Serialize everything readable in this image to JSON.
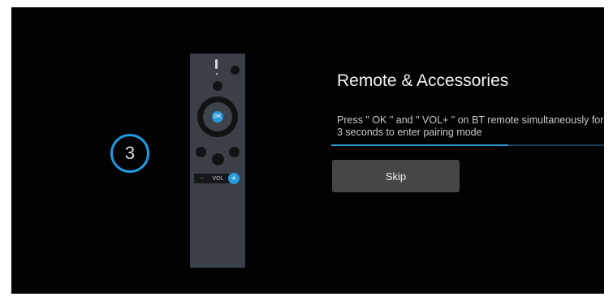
{
  "countdown": {
    "value": "3"
  },
  "remote": {
    "ok_label": "OK",
    "vol_minus": "−",
    "vol_label": "VOL",
    "vol_plus": "+"
  },
  "pairing": {
    "title": "Remote & Accessories",
    "message": "Press \" OK \" and \" VOL+ \" on BT remote simultaneously for 3 seconds to enter pairing mode",
    "progress_fraction": 0.65,
    "accent_color": "#2b98d8"
  },
  "actions": {
    "skip_label": "Skip"
  }
}
